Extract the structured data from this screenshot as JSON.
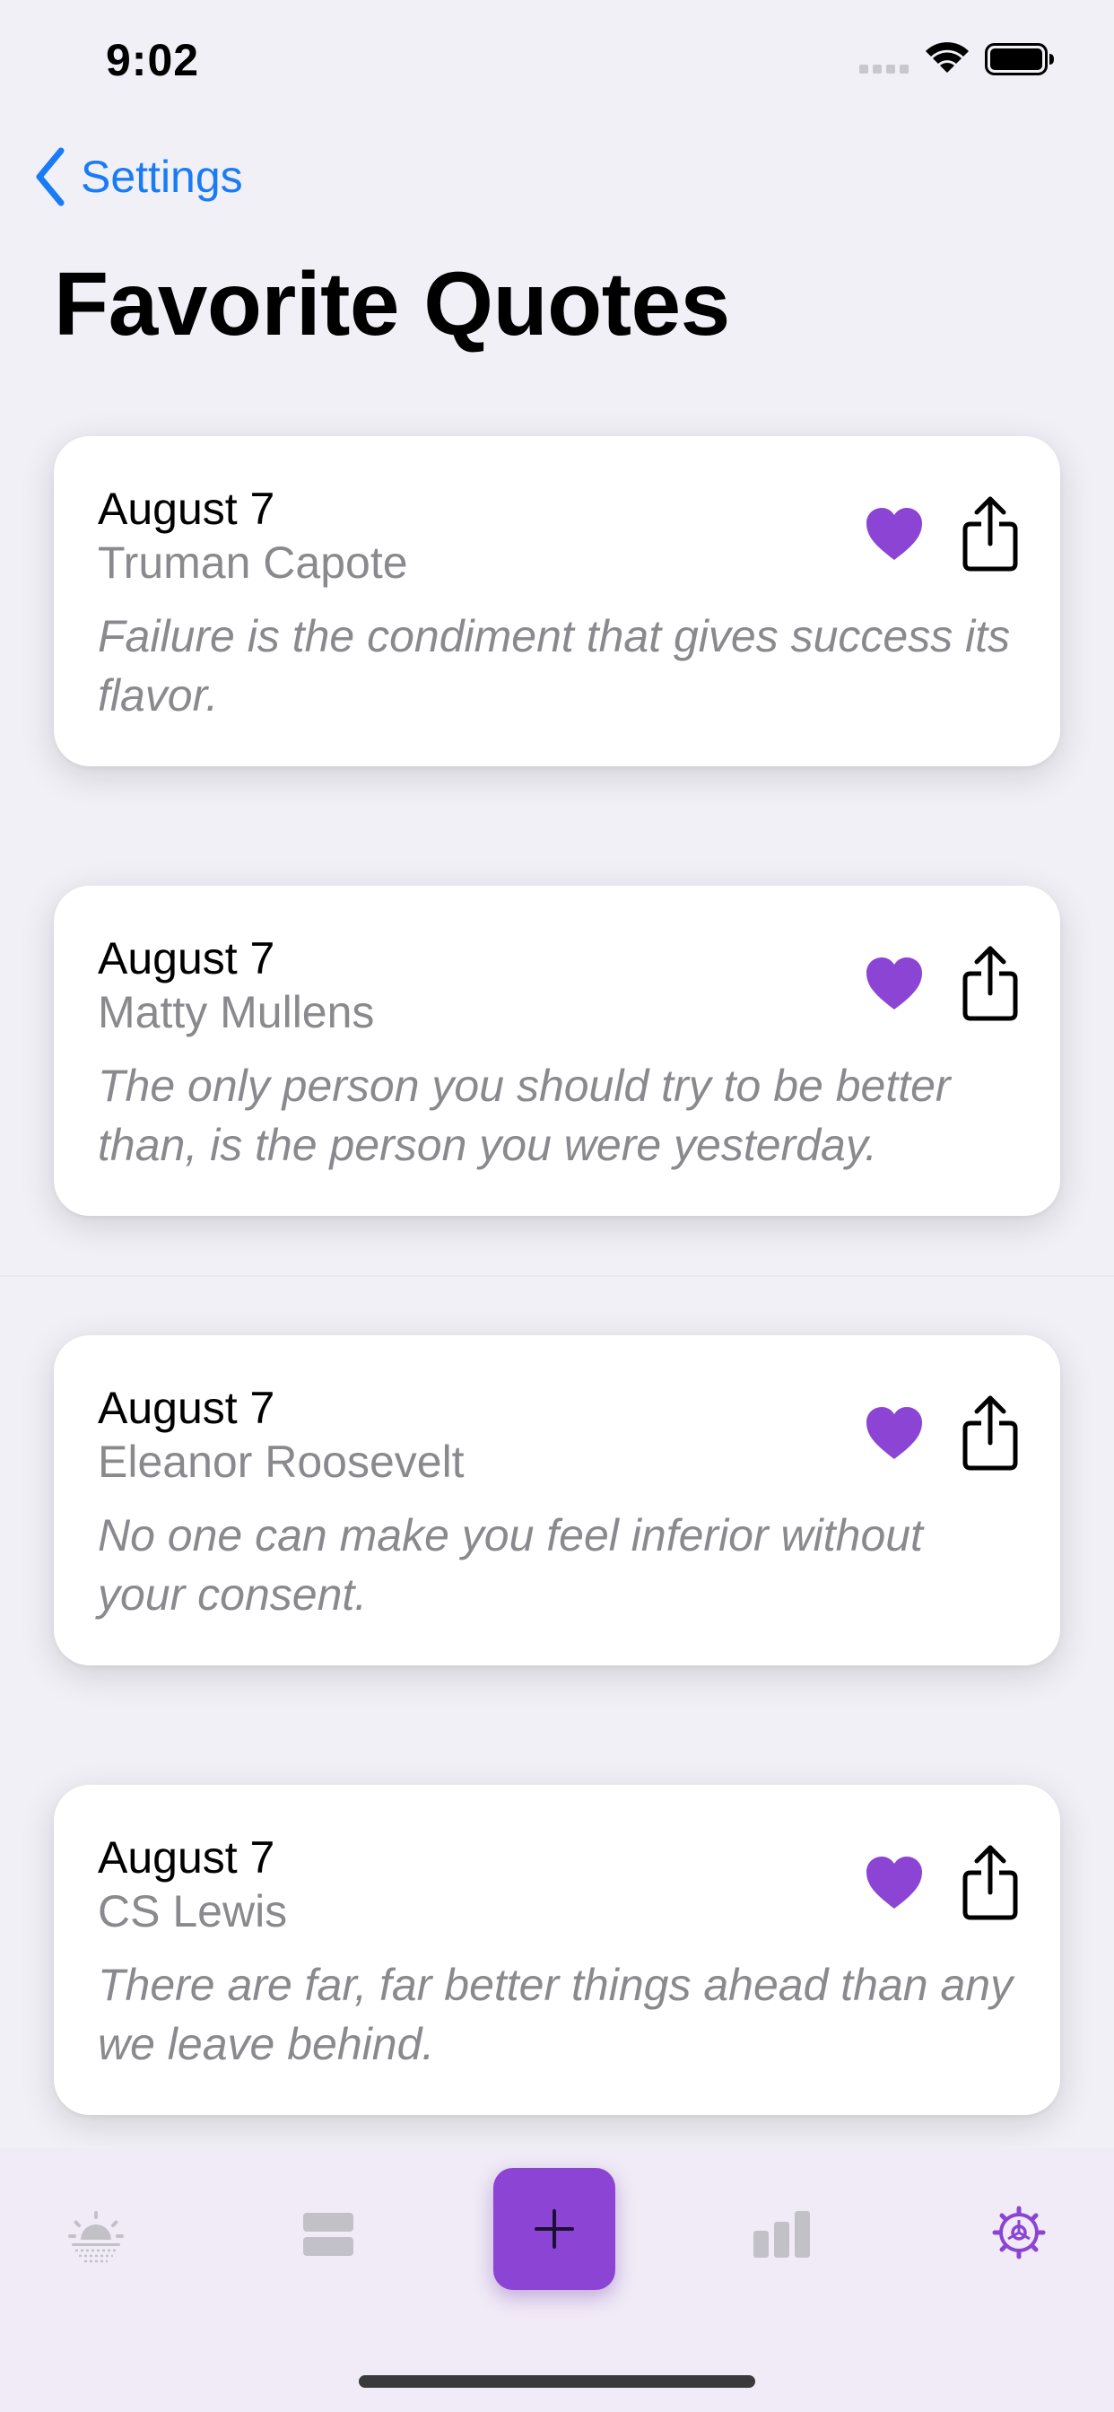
{
  "status_bar": {
    "time": "9:02"
  },
  "nav": {
    "back_label": "Settings",
    "title": "Favorite Quotes"
  },
  "quotes": [
    {
      "date": "August 7",
      "author": "Truman Capote",
      "text": "Failure is the condiment that gives success its flavor."
    },
    {
      "date": "August 7",
      "author": "Matty Mullens",
      "text": "The only person you should try to be better than, is the person you were yesterday."
    },
    {
      "date": "August 7",
      "author": "Eleanor Roosevelt",
      "text": "No one can make you feel inferior without your consent."
    },
    {
      "date": "August 7",
      "author": "CS Lewis",
      "text": "There are far, far better things ahead than any we leave behind."
    }
  ],
  "tab_bar": {
    "add_label": "+",
    "tabs": [
      {
        "icon": "sunrise-icon",
        "active": false
      },
      {
        "icon": "entries-icon",
        "active": false
      },
      {
        "icon": "stats-icon",
        "active": false
      },
      {
        "icon": "settings-gear-icon",
        "active": true
      }
    ]
  },
  "colors": {
    "accent": "#8c44d4",
    "link": "#1a7cf5",
    "background": "#f1f0f6",
    "secondary_text": "#8a8a8e",
    "tab_bar": "#f0ebf6",
    "inactive_icon": "#c3c1c8"
  }
}
